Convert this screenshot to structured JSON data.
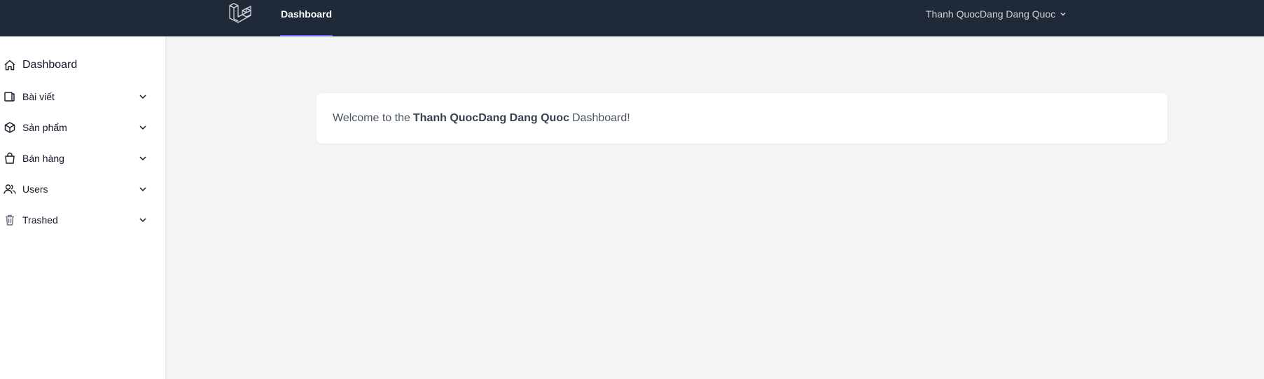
{
  "topbar": {
    "nav": {
      "dashboard": "Dashboard"
    },
    "user_name": "Thanh QuocDang Dang Quoc"
  },
  "sidebar": {
    "items": [
      {
        "label": "Dashboard",
        "icon": "home-icon"
      },
      {
        "label": "Bài viết",
        "icon": "document-icon"
      },
      {
        "label": "Sản phẩm",
        "icon": "cube-icon"
      },
      {
        "label": "Bán hàng",
        "icon": "shopping-bag-icon"
      },
      {
        "label": "Users",
        "icon": "users-icon"
      },
      {
        "label": "Trashed",
        "icon": "trash-icon"
      }
    ]
  },
  "main": {
    "welcome_prefix": "Welcome to the",
    "welcome_name": "Thanh QuocDang Dang Quoc",
    "welcome_suffix": "Dashboard!"
  },
  "colors": {
    "topbar_bg": "#1f2937",
    "nav_active_underline": "#6366f1",
    "page_bg": "#f3f4f6"
  }
}
